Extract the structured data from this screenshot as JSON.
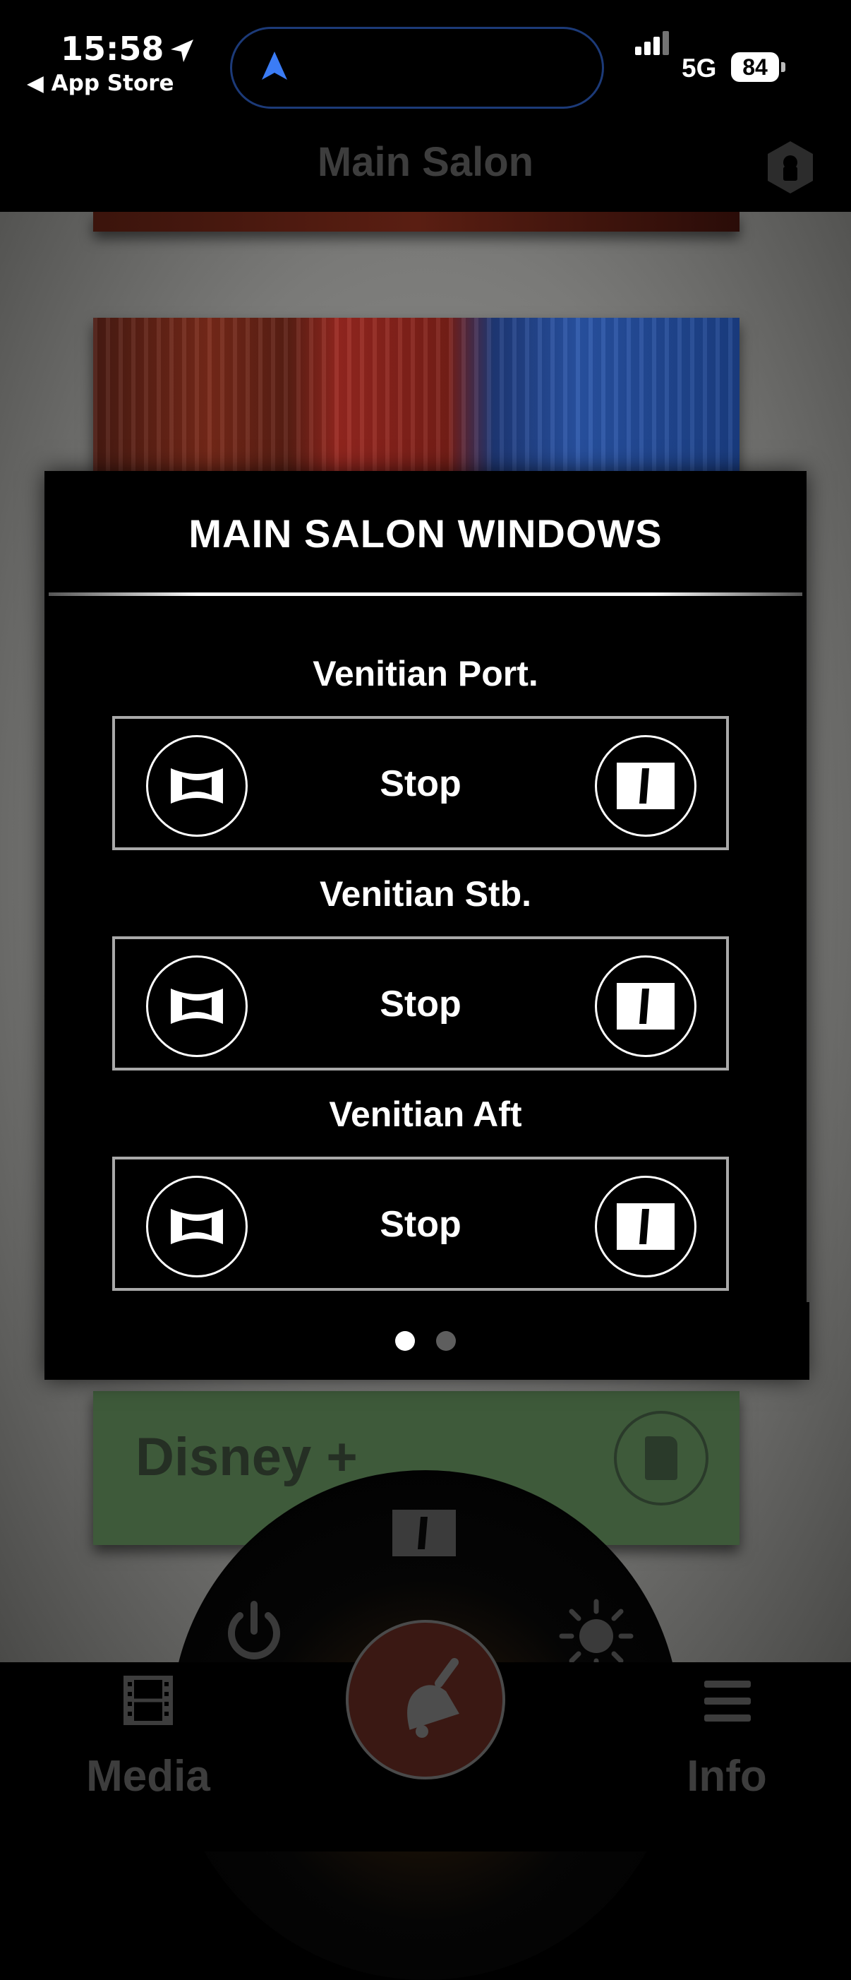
{
  "status_bar": {
    "time": "15:58",
    "back_app": "◀ App Store",
    "network": "5G",
    "battery": "84"
  },
  "header": {
    "title": "Main Salon"
  },
  "background_content": {
    "tile_label": "Disney +"
  },
  "modal": {
    "title": "MAIN SALON WINDOWS",
    "sections": [
      {
        "label": "Venitian Port.",
        "stop_label": "Stop"
      },
      {
        "label": "Venitian Stb.",
        "stop_label": "Stop"
      },
      {
        "label": "Venitian Aft",
        "stop_label": "Stop"
      }
    ],
    "page_count": 2,
    "current_page": 1
  },
  "tab_bar": {
    "left_label": "Media",
    "right_label": "Info"
  },
  "colors": {
    "accent_blue": "#1c3a78",
    "modal_bg": "#000000",
    "row_border": "#a9a9a9",
    "bell_button": "#3a1813"
  }
}
